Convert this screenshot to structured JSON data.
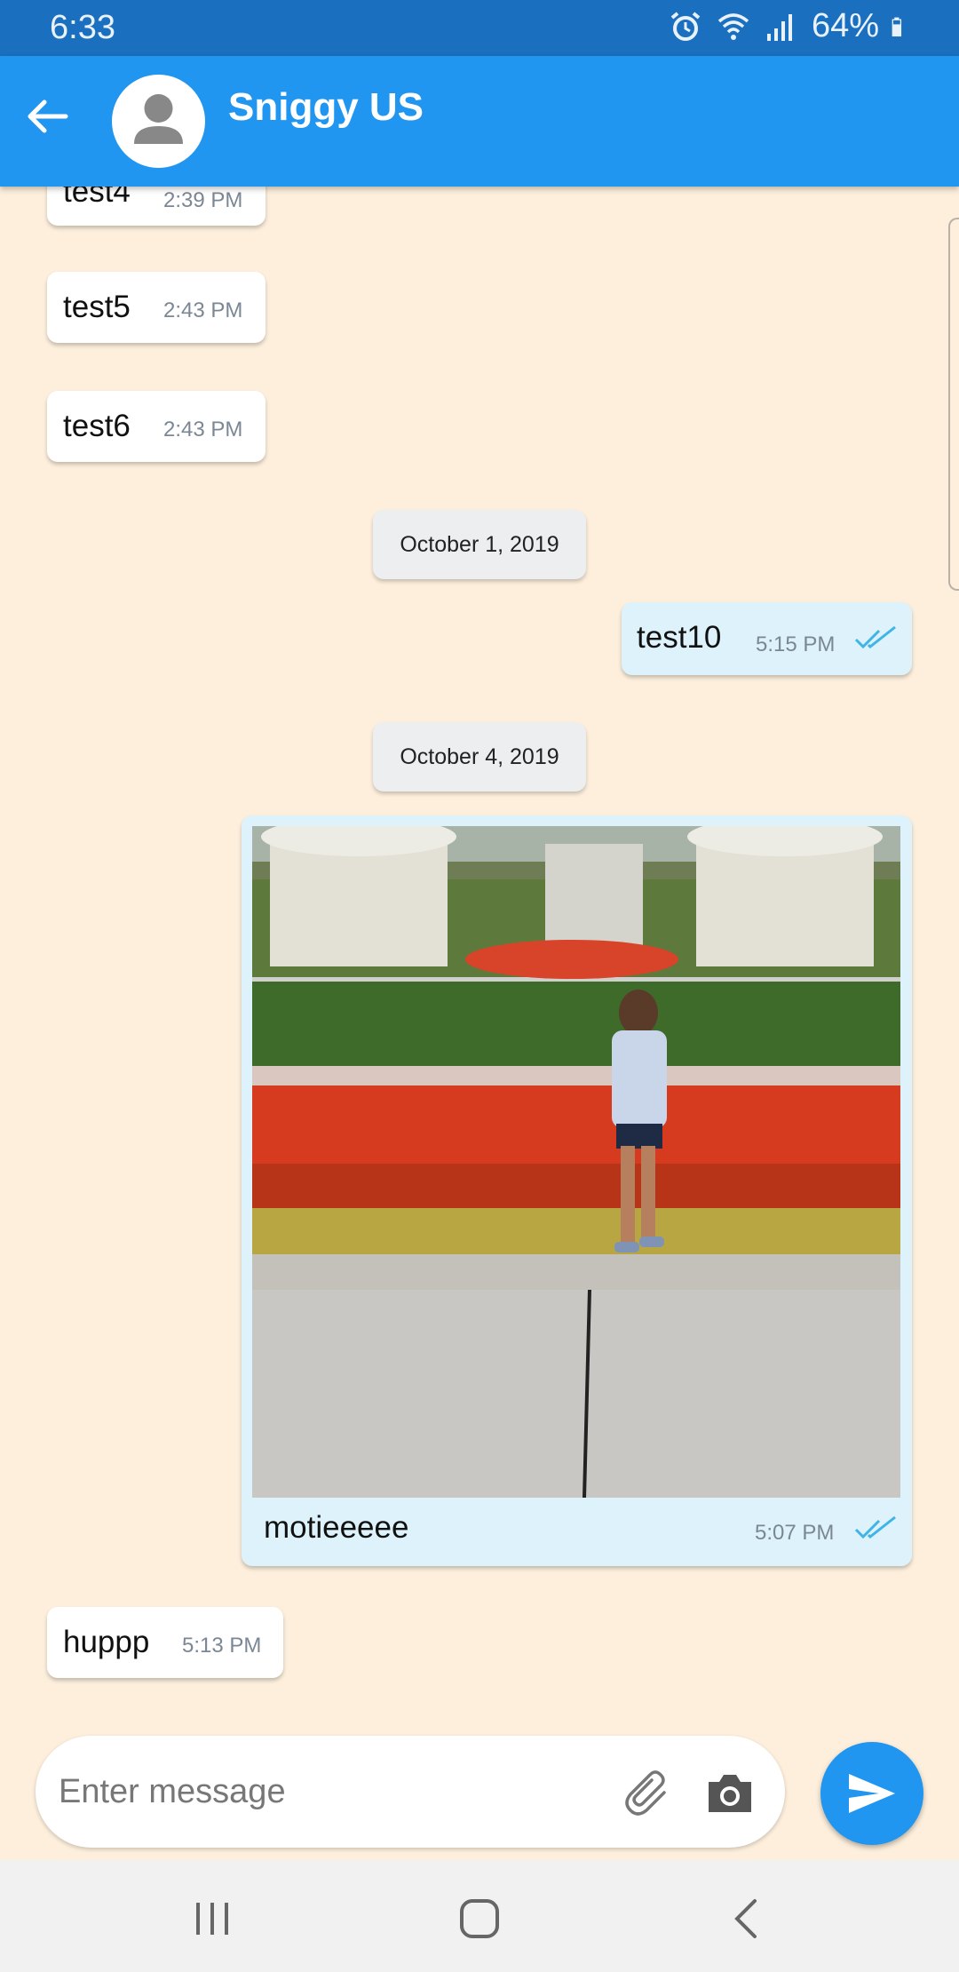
{
  "status_bar": {
    "time": "6:33",
    "battery": "64%",
    "icons": [
      "alarm-icon",
      "wifi-icon",
      "signal-icon",
      "battery-icon"
    ]
  },
  "header": {
    "contact_name": "Sniggy US",
    "back_icon": "arrow-left-icon",
    "avatar_icon": "person-icon"
  },
  "messages": [
    {
      "direction": "incoming",
      "text": "test4",
      "time": "2:39 PM"
    },
    {
      "direction": "incoming",
      "text": "test5",
      "time": "2:43 PM"
    },
    {
      "direction": "incoming",
      "text": "test6",
      "time": "2:43 PM"
    },
    {
      "type": "date",
      "text": "October 1, 2019"
    },
    {
      "direction": "outgoing",
      "text": "test10",
      "time": "5:15 PM",
      "status": "read"
    },
    {
      "type": "date",
      "text": "October 4, 2019"
    },
    {
      "direction": "outgoing",
      "type": "image",
      "caption": "motieeeee",
      "time": "5:07 PM",
      "status": "read"
    },
    {
      "direction": "incoming",
      "text": "huppp",
      "time": "5:13 PM"
    }
  ],
  "composer": {
    "placeholder": "Enter message",
    "attach_icon": "paperclip-icon",
    "camera_icon": "camera-icon",
    "send_icon": "send-icon"
  },
  "nav_bar": {
    "icons": [
      "recents-icon",
      "home-icon",
      "back-icon"
    ]
  },
  "colors": {
    "app_bar": "#2196f0",
    "status_bar": "#1a6fbf",
    "chat_background": "#fdefdc",
    "outgoing_bubble": "#ddf2fb",
    "read_ticks": "#3fb4e6"
  }
}
